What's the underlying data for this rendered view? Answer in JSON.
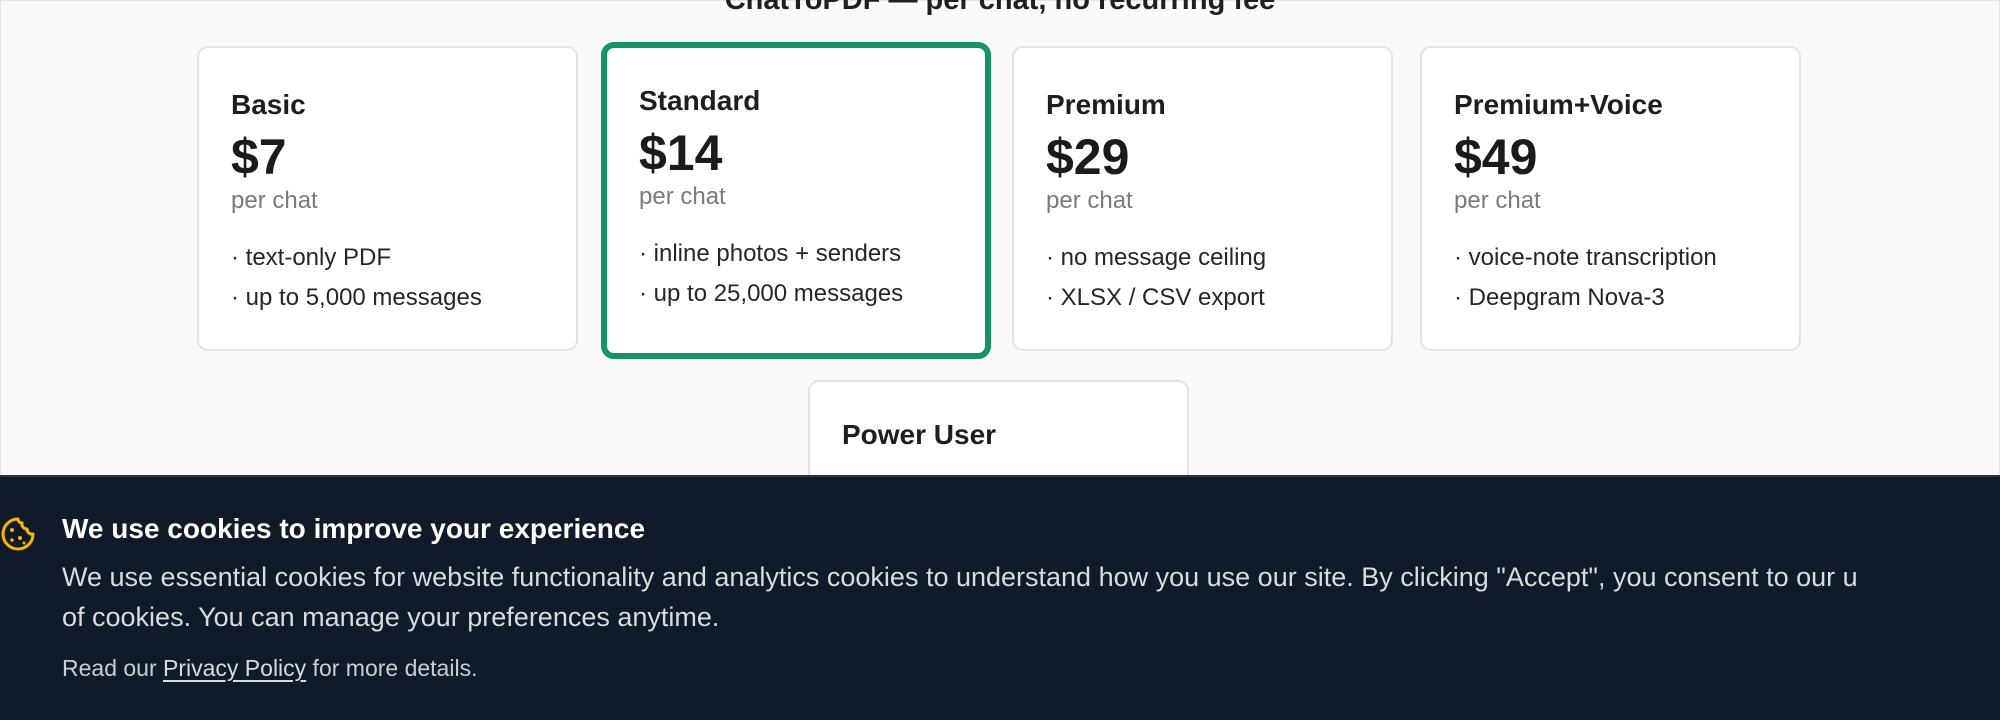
{
  "heading": "ChatToPDF — per chat, no recurring fee",
  "plans": [
    {
      "name": "Basic",
      "price": "$7",
      "period": "per chat",
      "features": [
        "· text-only PDF",
        "· up to 5,000 messages"
      ],
      "featured": false
    },
    {
      "name": "Standard",
      "price": "$14",
      "period": "per chat",
      "features": [
        "· inline photos + senders",
        "· up to 25,000 messages"
      ],
      "featured": true
    },
    {
      "name": "Premium",
      "price": "$29",
      "period": "per chat",
      "features": [
        "· no message ceiling",
        "· XLSX / CSV export"
      ],
      "featured": false
    },
    {
      "name": "Premium+Voice",
      "price": "$49",
      "period": "per chat",
      "features": [
        "· voice-note transcription",
        "· Deepgram Nova-3"
      ],
      "featured": false
    },
    {
      "name": "Power User",
      "price": "",
      "period": "",
      "features": [],
      "featured": false
    }
  ],
  "cookie_banner": {
    "title": "We use cookies to improve your experience",
    "body_line1": "We use essential cookies for website functionality and analytics cookies to understand how you use our site. By clicking \"Accept\", you consent to our u",
    "body_line2": "of cookies. You can manage your preferences anytime.",
    "note_prefix": "Read our ",
    "privacy_link": "Privacy Policy",
    "note_suffix": " for more details.",
    "icon": "cookie-icon"
  },
  "colors": {
    "featured_border": "#169466",
    "banner_bg": "#111a28",
    "cookie_icon": "#f5b800"
  }
}
